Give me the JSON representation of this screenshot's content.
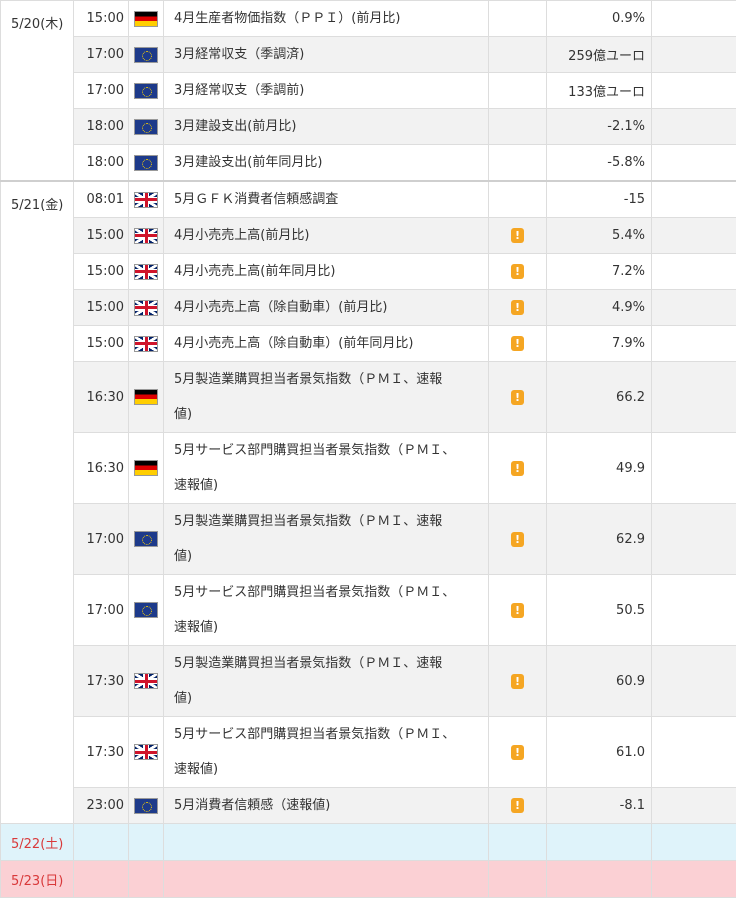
{
  "days": [
    {
      "date": "5/20(木)",
      "events": [
        {
          "time": "15:00",
          "flag": "germany-flag-icon",
          "event": "4月生産者物価指数（ＰＰＩ）(前月比)",
          "important": false,
          "value": "0.9%"
        },
        {
          "time": "17:00",
          "flag": "eu-flag-icon",
          "event": "3月経常収支（季調済)",
          "important": false,
          "value": "259億ユーロ"
        },
        {
          "time": "17:00",
          "flag": "eu-flag-icon",
          "event": "3月経常収支（季調前)",
          "important": false,
          "value": "133億ユーロ"
        },
        {
          "time": "18:00",
          "flag": "eu-flag-icon",
          "event": "3月建設支出(前月比)",
          "important": false,
          "value": "-2.1%"
        },
        {
          "time": "18:00",
          "flag": "eu-flag-icon",
          "event": "3月建設支出(前年同月比)",
          "important": false,
          "value": "-5.8%"
        }
      ]
    },
    {
      "date": "5/21(金)",
      "events": [
        {
          "time": "08:01",
          "flag": "uk-flag-icon",
          "event": "5月ＧＦＫ消費者信頼感調査",
          "important": false,
          "value": "-15"
        },
        {
          "time": "15:00",
          "flag": "uk-flag-icon",
          "event": "4月小売売上高(前月比)",
          "important": true,
          "value": "5.4%"
        },
        {
          "time": "15:00",
          "flag": "uk-flag-icon",
          "event": "4月小売売上高(前年同月比)",
          "important": true,
          "value": "7.2%"
        },
        {
          "time": "15:00",
          "flag": "uk-flag-icon",
          "event": "4月小売売上高（除自動車）(前月比)",
          "important": true,
          "value": "4.9%"
        },
        {
          "time": "15:00",
          "flag": "uk-flag-icon",
          "event": "4月小売売上高（除自動車）(前年同月比)",
          "important": true,
          "value": "7.9%"
        },
        {
          "time": "16:30",
          "flag": "germany-flag-icon",
          "event_lines": [
            "5月製造業購買担当者景気指数（ＰＭＩ、速報",
            "値)"
          ],
          "important": true,
          "value": "66.2"
        },
        {
          "time": "16:30",
          "flag": "germany-flag-icon",
          "event_lines": [
            "5月サービス部門購買担当者景気指数（ＰＭＩ、",
            "速報値)"
          ],
          "important": true,
          "value": "49.9"
        },
        {
          "time": "17:00",
          "flag": "eu-flag-icon",
          "event_lines": [
            "5月製造業購買担当者景気指数（ＰＭＩ、速報",
            "値)"
          ],
          "important": true,
          "value": "62.9"
        },
        {
          "time": "17:00",
          "flag": "eu-flag-icon",
          "event_lines": [
            "5月サービス部門購買担当者景気指数（ＰＭＩ、",
            "速報値)"
          ],
          "important": true,
          "value": "50.5"
        },
        {
          "time": "17:30",
          "flag": "uk-flag-icon",
          "event_lines": [
            "5月製造業購買担当者景気指数（ＰＭＩ、速報",
            "値)"
          ],
          "important": true,
          "value": "60.9"
        },
        {
          "time": "17:30",
          "flag": "uk-flag-icon",
          "event_lines": [
            "5月サービス部門購買担当者景気指数（ＰＭＩ、",
            "速報値)"
          ],
          "important": true,
          "value": "61.0"
        },
        {
          "time": "23:00",
          "flag": "eu-flag-icon",
          "event": "5月消費者信頼感（速報値)",
          "important": true,
          "value": "-8.1"
        }
      ]
    },
    {
      "date": "5/22(土)",
      "events": []
    },
    {
      "date": "5/23(日)",
      "events": []
    }
  ],
  "warn_glyph": "!",
  "colors": {
    "weekend_text": "#d9393a",
    "saturday_bg": "#dff3fa",
    "sunday_bg": "#fbd0d4",
    "alt_row_bg": "#f2f2f2",
    "warn": "#f5a623"
  }
}
